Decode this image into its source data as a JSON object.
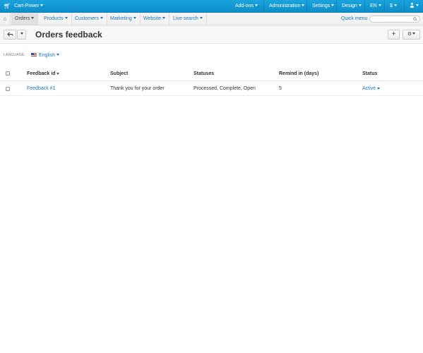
{
  "topbar": {
    "brand": "Cart-Power",
    "menu": [
      "Add-ons",
      "Administration",
      "Settings",
      "Design",
      "EN",
      "$"
    ]
  },
  "subnav": {
    "items": [
      "Orders",
      "Products",
      "Customers",
      "Marketing",
      "Website",
      "Live search"
    ],
    "quick_menu": "Quick menu",
    "search_placeholder": ""
  },
  "page": {
    "title": "Orders feedback"
  },
  "language": {
    "label": "LANGUAGE:",
    "selected": "English"
  },
  "table": {
    "headers": {
      "feedback_id": "Feedback id",
      "subject": "Subject",
      "statuses": "Statuses",
      "remind": "Remind in (days)",
      "status": "Status"
    },
    "rows": [
      {
        "feedback_id": "Feedback #1",
        "subject": "Thank you for your order",
        "statuses": "Processed, Complete, Open",
        "remind": "5",
        "status": "Active"
      }
    ]
  },
  "colors": {
    "topbar": "#1aa3de",
    "link": "#1b78b8",
    "subnav_bg": "#f2f2f2"
  },
  "icons": {
    "logo": "cart-icon",
    "home": "home-icon",
    "user": "user-icon",
    "back": "back-arrow-icon",
    "add": "plus-icon",
    "settings": "gear-icon",
    "search": "search-icon"
  }
}
